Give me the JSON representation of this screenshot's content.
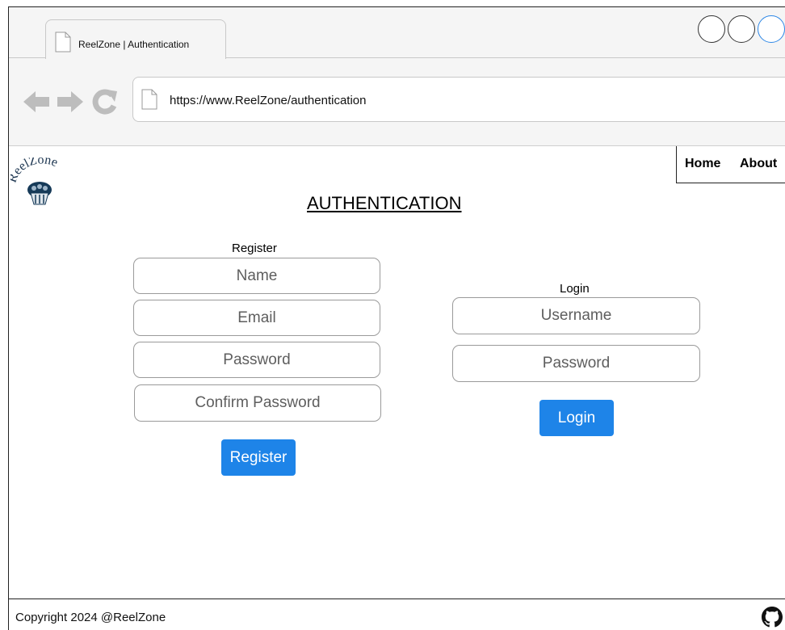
{
  "browser": {
    "tab_title": "ReelZone | Authentication",
    "url": "https://www.ReelZone/authentication",
    "icons": [
      "back-arrow-icon",
      "forward-arrow-icon",
      "reload-icon",
      "page-icon"
    ],
    "accent": "#2b86e6"
  },
  "site": {
    "logo_text": "ReelZone",
    "nav": {
      "home": "Home",
      "about": "About"
    }
  },
  "page": {
    "title": "AUTHENTICATION",
    "register": {
      "heading": "Register",
      "name_placeholder": "Name",
      "email_placeholder": "Email",
      "password_placeholder": "Password",
      "confirm_placeholder": "Confirm Password",
      "button": "Register"
    },
    "login": {
      "heading": "Login",
      "username_placeholder": "Username",
      "password_placeholder": "Password",
      "button": "Login"
    },
    "button_color": "#1e84e8"
  },
  "footer": {
    "copyright": "Copyright 2024 @ReelZone",
    "icon": "github-icon"
  }
}
